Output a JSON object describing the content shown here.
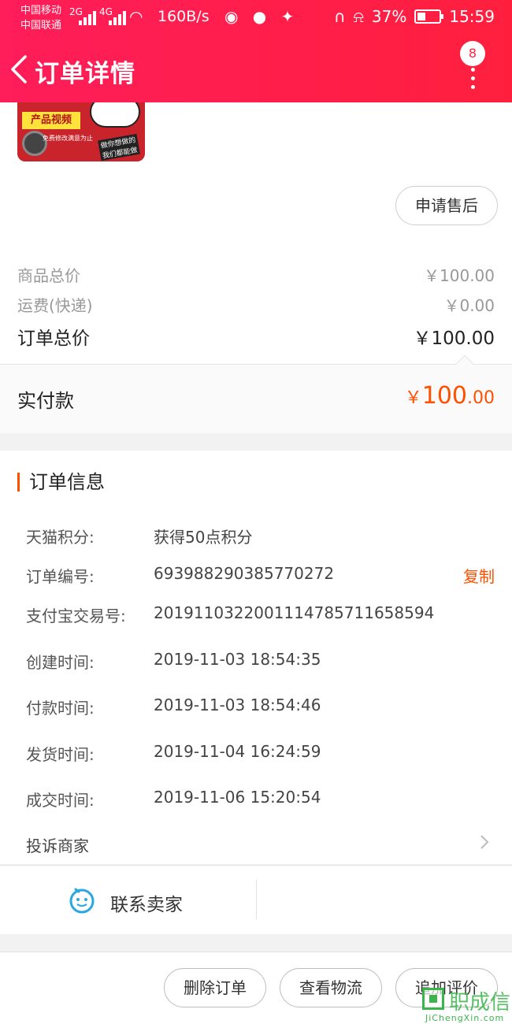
{
  "status_bar": {
    "carrier1": "中国移动",
    "carrier2": "中国联通",
    "net1": "2G",
    "net2": "4G",
    "speed": "160B/s",
    "battery": "37%",
    "time": "15:59"
  },
  "header": {
    "title": "订单详情",
    "badge": "8"
  },
  "product": {
    "thumb_text": "产品视频",
    "thumb_sub": "免费修改满意为止",
    "thumb_slogan": "做你想做的 我们都能做",
    "after_sale_label": "申请售后"
  },
  "prices": {
    "goods_label": "商品总价",
    "goods_value": "￥100.00",
    "shipping_label": "运费(快递)",
    "shipping_value": "￥0.00",
    "total_label": "订单总价",
    "total_value": "￥100.00",
    "paid_label": "实付款",
    "paid_currency": "￥",
    "paid_int": "100",
    "paid_dec": ".00"
  },
  "order_info": {
    "title": "订单信息",
    "rows": [
      {
        "key": "天猫积分:",
        "value": "获得50点积分"
      },
      {
        "key": "订单编号:",
        "value": "693988290385770272"
      },
      {
        "key": "支付宝交易号:",
        "value": "2019110322001114785711658594"
      },
      {
        "key": "创建时间:",
        "value": "2019-11-03 18:54:35"
      },
      {
        "key": "付款时间:",
        "value": "2019-11-03 18:54:46"
      },
      {
        "key": "发货时间:",
        "value": "2019-11-04 16:24:59"
      },
      {
        "key": "成交时间:",
        "value": "2019-11-06 15:20:54"
      }
    ],
    "copy_label": "复制",
    "complain_label": "投诉商家"
  },
  "contact": {
    "label": "联系卖家"
  },
  "footer": {
    "delete_label": "删除订单",
    "logistics_label": "查看物流",
    "review_label": "追加评价"
  },
  "watermark": {
    "cn": "职成信",
    "en": "JiChengXin.com"
  },
  "colors": {
    "header_red": "#ff1f3d",
    "accent_orange": "#ff5000",
    "contact_blue": "#29a8e0"
  }
}
